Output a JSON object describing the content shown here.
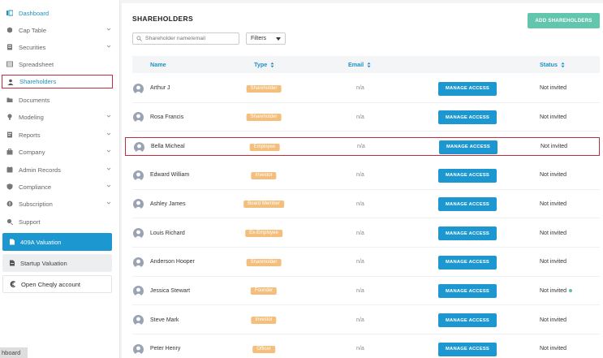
{
  "sidebar": {
    "items": [
      {
        "label": "Dashboard",
        "icon": "dashboard-icon",
        "active": true,
        "has_chevron": false
      },
      {
        "label": "Cap Table",
        "icon": "cap-table-icon",
        "has_chevron": true
      },
      {
        "label": "Securities",
        "icon": "securities-icon",
        "has_chevron": true
      },
      {
        "label": "Spreadsheet",
        "icon": "spreadsheet-icon",
        "has_chevron": false
      },
      {
        "label": "Shareholders",
        "icon": "shareholders-icon",
        "selected": true,
        "has_chevron": false
      },
      {
        "label": "Documents",
        "icon": "documents-icon",
        "has_chevron": false
      },
      {
        "label": "Modeling",
        "icon": "modeling-icon",
        "has_chevron": true
      },
      {
        "label": "Reports",
        "icon": "reports-icon",
        "has_chevron": true
      },
      {
        "label": "Company",
        "icon": "company-icon",
        "has_chevron": true
      },
      {
        "label": "Admin Records",
        "icon": "admin-records-icon",
        "has_chevron": true
      },
      {
        "label": "Compliance",
        "icon": "compliance-icon",
        "has_chevron": true
      },
      {
        "label": "Subscription",
        "icon": "subscription-icon",
        "has_chevron": true
      },
      {
        "label": "Support",
        "icon": "support-icon",
        "has_chevron": false
      }
    ],
    "valuation_409a": "409A Valuation",
    "startup_valuation": "Startup Valuation",
    "open_cheqly": "Open Cheqly account",
    "footer_chip": "hboard"
  },
  "header": {
    "title": "SHAREHOLDERS",
    "add_button": "ADD SHAREHOLDERS"
  },
  "toolbar": {
    "search_placeholder": "Shareholder name/email",
    "filters_label": "Filters"
  },
  "table": {
    "columns": {
      "name": "Name",
      "type": "Type",
      "email": "Email",
      "status": "Status"
    },
    "action_label": "MANAGE ACCESS",
    "rows": [
      {
        "name": "Arthur J",
        "type": "Shareholder",
        "email": "n/a",
        "status": "Not invited"
      },
      {
        "name": "Rosa Francis",
        "type": "Shareholder",
        "email": "n/a",
        "status": "Not invited"
      },
      {
        "name": "Bella Micheal",
        "type": "Employee",
        "email": "n/a",
        "status": "Not invited"
      },
      {
        "name": "Edward William",
        "type": "Investor",
        "email": "n/a",
        "status": "Not invited"
      },
      {
        "name": "Ashley James",
        "type": "Board Member",
        "email": "n/a",
        "status": "Not invited"
      },
      {
        "name": "Louis Richard",
        "type": "Ex-Employee",
        "email": "n/a",
        "status": "Not invited"
      },
      {
        "name": "Anderson Hooper",
        "type": "Shareholder",
        "email": "n/a",
        "status": "Not invited"
      },
      {
        "name": "Jessica Stewart",
        "type": "Founder",
        "email": "n/a",
        "status": "Not invited"
      },
      {
        "name": "Steve Mark",
        "type": "Investor",
        "email": "n/a",
        "status": "Not invited"
      },
      {
        "name": "Peter Henry",
        "type": "Officer",
        "email": "n/a",
        "status": "Not invited"
      }
    ]
  },
  "colors": {
    "accent": "#1d97cf",
    "add_button": "#62c6ae",
    "badge": "#f4bf7c",
    "highlight_border": "#c22c3c",
    "status_dot": "#5fbfa3"
  }
}
